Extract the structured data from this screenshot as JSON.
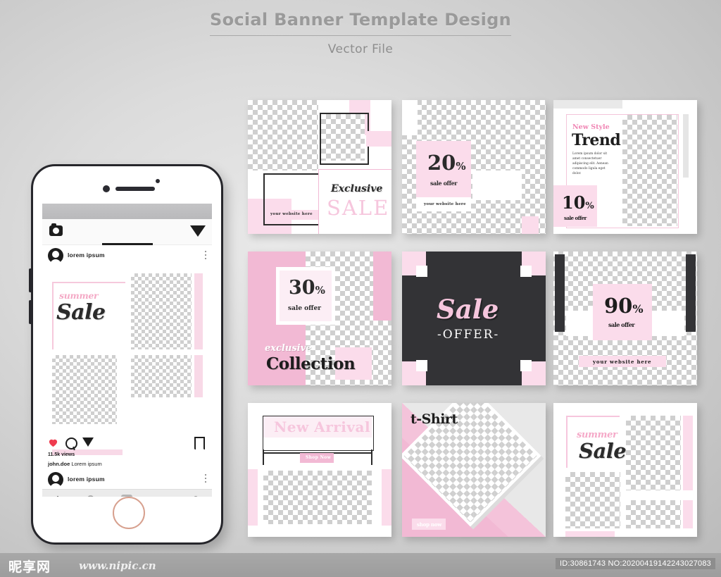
{
  "header": {
    "title": "Social Banner Template Design",
    "subtitle": "Vector File"
  },
  "phone": {
    "app": {
      "post_username": "lorem ipsum",
      "summer_label": "summer",
      "sale_label": "Sale",
      "views": "11.5k views",
      "caption_user": "john.doe",
      "caption_text": "Lorem ipsum",
      "second_post_username": "lorem ipsum",
      "icons": {
        "camera": "camera-icon",
        "send": "send-icon",
        "like": "heart-icon",
        "comment": "comment-icon",
        "share": "share-icon",
        "save": "bookmark-icon",
        "more": "more-dots-icon",
        "nav_home": "home-icon",
        "nav_search": "search-icon",
        "nav_reels": "reels-icon",
        "nav_activity": "heart-icon",
        "nav_profile": "profile-icon"
      }
    }
  },
  "cards": [
    {
      "id": "card-exclusive-sale",
      "website": "your website here",
      "title_script": "Exclusive",
      "title_block": "SALE"
    },
    {
      "id": "card-20-percent",
      "percent": "20",
      "percent_symbol": "%",
      "sale_offer": "sale offer",
      "website": "your website here"
    },
    {
      "id": "card-new-style-trend",
      "eyebrow": "New Style",
      "title": "Trend",
      "body": "Lorem ipsum dolor sit amet consectetuer adipiscing elit. Aenean commodo ligula eget dolor.",
      "percent": "10",
      "percent_symbol": "%",
      "sale_offer": "sale offer"
    },
    {
      "id": "card-30-collection",
      "percent": "30",
      "percent_symbol": "%",
      "sale_offer": "sale offer",
      "eyebrow": "exclusive",
      "title": "Collection"
    },
    {
      "id": "card-sale-offer-dark",
      "title_script": "Sale",
      "subtitle": "-OFFER-"
    },
    {
      "id": "card-90-percent",
      "percent": "90",
      "percent_symbol": "%",
      "sale_offer": "sale offer",
      "website": "your website here"
    },
    {
      "id": "card-new-arrival",
      "title": "New Arrival",
      "button": "Shop Now"
    },
    {
      "id": "card-t-shirt",
      "title": "t-Shirt",
      "button": "shop now"
    },
    {
      "id": "card-summer-sale",
      "summer_label": "summer",
      "sale_label": "Sale"
    }
  ],
  "watermark": {
    "logo": "昵享网",
    "url": "www.nipic.cn",
    "id_text": "ID:30861743 NO:20200419142243027083"
  },
  "colors": {
    "pink": "#f2b9d4",
    "pink_light": "#fbdceb",
    "pink_pale": "#fceef5",
    "dark": "#333336",
    "text_dark": "#2b2b2b",
    "accent_script": "#f4aac6"
  }
}
